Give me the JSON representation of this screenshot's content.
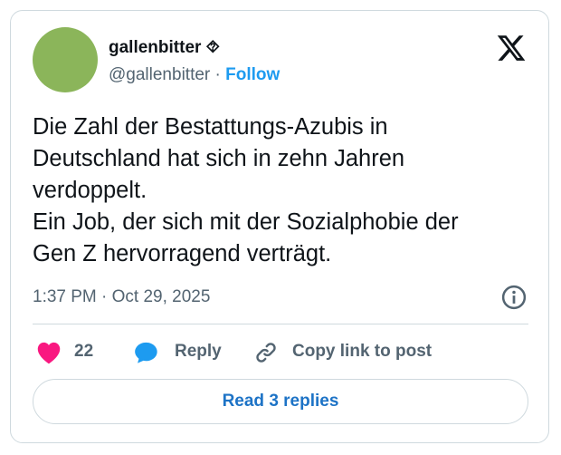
{
  "author": {
    "name": "gallenbitter",
    "name_suffix": "⯑",
    "handle": "@gallenbitter",
    "separator": "·",
    "follow_label": "Follow",
    "avatar_color": "#8bb55a"
  },
  "platform_icon": "x-logo-icon",
  "tweet": {
    "lines": [
      "Die Zahl der Bestattungs-Azubis in",
      "Deutschland hat sich in zehn Jahren",
      "verdoppelt.",
      "Ein Job, der sich mit der Sozialphobie der",
      "Gen Z hervorragend verträgt."
    ]
  },
  "timestamp": "1:37 PM · Oct 29, 2025",
  "actions": {
    "like_count": "22",
    "reply_label": "Reply",
    "copy_link_label": "Copy link to post"
  },
  "read_replies_label": "Read 3 replies",
  "colors": {
    "accent": "#1d9bf0",
    "heart": "#f91880",
    "reply_icon": "#1d9bf0",
    "text": "#0f1419",
    "muted": "#536471",
    "border": "#cfd9de"
  }
}
